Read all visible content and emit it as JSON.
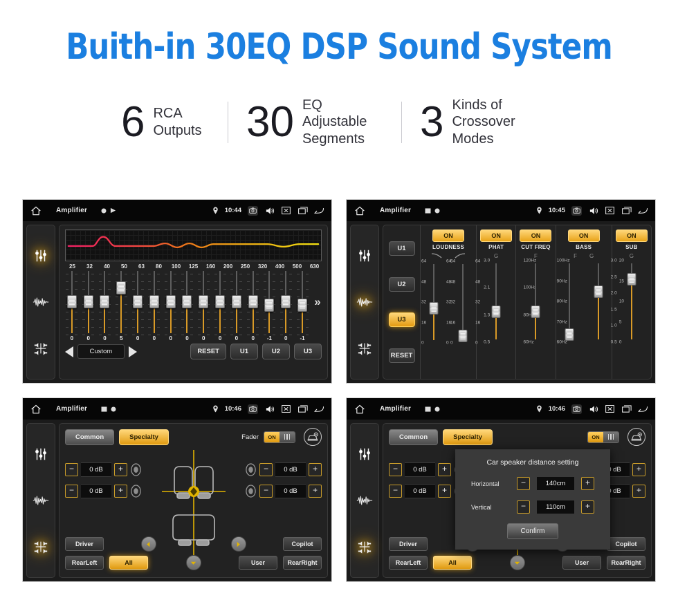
{
  "hero": {
    "title": "Buith-in 30EQ DSP Sound System",
    "color": "#1b7fe0"
  },
  "stats": [
    {
      "number": "6",
      "line1": "RCA",
      "line2": "Outputs"
    },
    {
      "number": "30",
      "line1": "EQ Adjustable",
      "line2": "Segments"
    },
    {
      "number": "3",
      "line1": "Kinds of",
      "line2": "Crossover Modes"
    }
  ],
  "panel1": {
    "statusbar": {
      "title": "Amplifier",
      "time": "10:44",
      "icons": [
        "home-icon",
        "record-dot-icon",
        "play-icon",
        "location-pin-icon",
        "camera-icon",
        "volume-icon",
        "close-box-icon",
        "recents-icon",
        "back-icon"
      ]
    },
    "sidebar": [
      {
        "name": "equalizer-icon",
        "active": true
      },
      {
        "name": "waveform-icon",
        "active": false
      },
      {
        "name": "balance-icon",
        "active": false
      }
    ],
    "freq_labels": [
      "25",
      "32",
      "40",
      "50",
      "63",
      "80",
      "100",
      "125",
      "160",
      "200",
      "250",
      "320",
      "400",
      "500",
      "630"
    ],
    "slider_values": [
      "0",
      "0",
      "0",
      "5",
      "0",
      "0",
      "0",
      "0",
      "0",
      "0",
      "0",
      "0",
      "-1",
      "0",
      "-1"
    ],
    "slider_positions": [
      50,
      50,
      50,
      72,
      50,
      50,
      50,
      50,
      50,
      50,
      50,
      50,
      44,
      50,
      44
    ],
    "more_icon": "chevron-double-right-icon",
    "bottom": {
      "prev": "prev-preset-arrow",
      "preset": "Custom",
      "next": "next-preset-arrow",
      "reset": "RESET",
      "u1": "U1",
      "u2": "U2",
      "u3": "U3"
    }
  },
  "panel2": {
    "statusbar": {
      "title": "Amplifier",
      "time": "10:45"
    },
    "sidebar": [
      {
        "name": "equalizer-icon",
        "active": false
      },
      {
        "name": "waveform-icon",
        "active": true
      },
      {
        "name": "balance-icon",
        "active": false
      }
    ],
    "presets": [
      {
        "label": "U1",
        "on": false
      },
      {
        "label": "U2",
        "on": false
      },
      {
        "label": "U3",
        "on": true
      },
      {
        "label": "RESET",
        "on": false
      }
    ],
    "columns": [
      {
        "label": "LOUDNESS",
        "state": "ON",
        "sliders": [
          {
            "sub": "curve-down-icon",
            "scale": [
              "64",
              "48",
              "32",
              "16",
              "0"
            ],
            "pos": 38
          },
          {
            "sub": "curve-up-icon",
            "scale": [
              "64",
              "48",
              "32",
              "16",
              "0"
            ],
            "pos": 4
          }
        ]
      },
      {
        "label": "PHAT",
        "state": "ON",
        "sliders": [
          {
            "sub": "G",
            "scale": [
              "3.0",
              "2.1",
              "1.3",
              "0.5"
            ],
            "pos": 33
          }
        ]
      },
      {
        "label": "CUT FREQ",
        "state": "ON",
        "sliders": [
          {
            "sub": "F",
            "scale": [
              "120Hz",
              "100Hz",
              "80Hz",
              "60Hz"
            ],
            "pos": 33
          }
        ]
      },
      {
        "label": "BASS",
        "state": "ON",
        "sliders": [
          {
            "sub": "F",
            "scale": [
              "100Hz",
              "90Hz",
              "80Hz",
              "70Hz",
              "60Hz"
            ],
            "pos": 5
          },
          {
            "sub": "G",
            "scale": [
              "3.0",
              "2.5",
              "2.0",
              "1.5",
              "1.0",
              "0.5"
            ],
            "pos": 58
          }
        ]
      },
      {
        "label": "SUB",
        "state": "ON",
        "sliders": [
          {
            "sub": "G",
            "scale": [
              "20",
              "15",
              "10",
              "5",
              "0"
            ],
            "pos": 73
          }
        ]
      }
    ]
  },
  "panel3": {
    "statusbar": {
      "title": "Amplifier",
      "time": "10:46"
    },
    "sidebar": [
      {
        "name": "equalizer-icon",
        "active": false
      },
      {
        "name": "waveform-icon",
        "active": false
      },
      {
        "name": "balance-icon",
        "active": true
      }
    ],
    "tabs": [
      {
        "label": "Common",
        "on": false
      },
      {
        "label": "Specialty",
        "on": true
      }
    ],
    "fader_label": "Fader",
    "fader_state": "ON",
    "car_settings_icon": "car-gear-icon",
    "steppers": [
      {
        "pos": "front-left",
        "value": "0 dB"
      },
      {
        "pos": "rear-left",
        "value": "0 dB"
      },
      {
        "pos": "front-right",
        "value": "0 dB"
      },
      {
        "pos": "rear-right",
        "value": "0 dB"
      }
    ],
    "buttons": {
      "driver": {
        "label": "Driver",
        "on": false
      },
      "copilot": {
        "label": "Copilot",
        "on": false
      },
      "rearleft": {
        "label": "RearLeft",
        "on": false
      },
      "all": {
        "label": "All",
        "on": true
      },
      "user": {
        "label": "User",
        "on": false
      },
      "rearright": {
        "label": "RearRight",
        "on": false
      }
    },
    "nav_icons": [
      "nav-up-icon",
      "nav-left-icon",
      "nav-right-icon",
      "nav-down-icon"
    ]
  },
  "panel4": {
    "statusbar": {
      "title": "Amplifier",
      "time": "10:46"
    },
    "modal": {
      "title": "Car speaker distance setting",
      "rows": [
        {
          "label": "Horizontal",
          "value": "140cm"
        },
        {
          "label": "Vertical",
          "value": "110cm"
        }
      ],
      "confirm": "Confirm",
      "minus": "−",
      "plus": "+"
    }
  },
  "common": {
    "minus": "−",
    "plus": "+"
  }
}
